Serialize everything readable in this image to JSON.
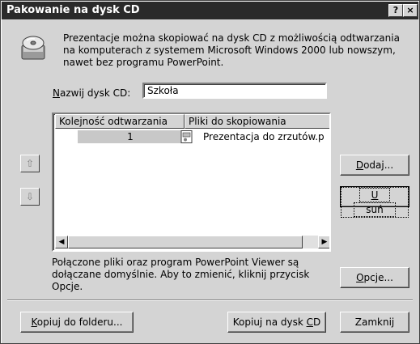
{
  "window": {
    "title": "Pakowanie na dysk CD"
  },
  "titlebar_buttons": {
    "help": "?",
    "close": "×"
  },
  "info_text": "Prezentacje można skopiować na dysk CD z możliwością odtwarzania na komputerach z systemem Microsoft Windows 2000 lub nowszym, nawet bez programu PowerPoint.",
  "cd_name": {
    "label_first": "N",
    "label_rest": "azwij dysk CD:",
    "value": "Szkoła"
  },
  "list": {
    "columns": [
      "Kolejność odtwarzania",
      "Pliki do skopiowania"
    ],
    "rows": [
      {
        "order": "1",
        "file": "Prezentacja do zrzutów.p"
      }
    ]
  },
  "buttons": {
    "dodaj_first": "D",
    "dodaj_rest": "odaj...",
    "usun_first": "U",
    "usun_rest": "suń",
    "opcje_first": "O",
    "opcje_rest": "pcje...",
    "kopiuj_folder_first": "K",
    "kopiuj_folder_rest": "opiuj do folderu...",
    "kopiuj_cd_prefix": "Kopiuj na dysk ",
    "kopiuj_cd_u": "C",
    "kopiuj_cd_suffix": "D",
    "zamknij": "Zamknij"
  },
  "note_text": "Połączone pliki oraz program PowerPoint Viewer są dołączane domyślnie. Aby to zmienić, kliknij przycisk Opcje.",
  "icons": {
    "up": "arrow-up-icon",
    "down": "arrow-down-icon",
    "cd": "cd-package-icon",
    "file": "powerpoint-file-icon"
  }
}
